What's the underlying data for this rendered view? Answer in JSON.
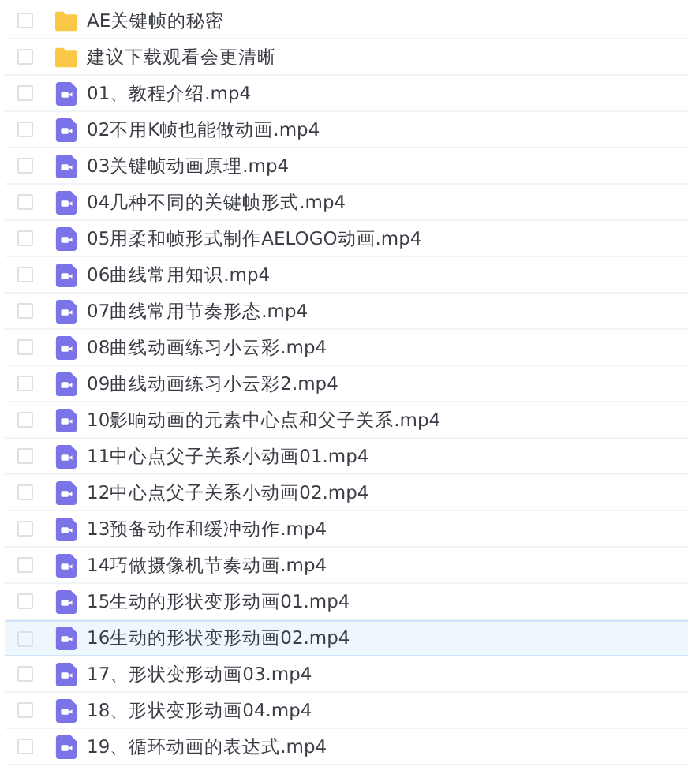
{
  "files": [
    {
      "name": "AE关键帧的秘密",
      "kind": "folder",
      "selected": false
    },
    {
      "name": "建议下载观看会更清晰",
      "kind": "folder",
      "selected": false
    },
    {
      "name": "01、教程介绍.mp4",
      "kind": "video",
      "selected": false
    },
    {
      "name": "02不用K帧也能做动画.mp4",
      "kind": "video",
      "selected": false
    },
    {
      "name": "03关键帧动画原理.mp4",
      "kind": "video",
      "selected": false
    },
    {
      "name": "04几种不同的关键帧形式.mp4",
      "kind": "video",
      "selected": false
    },
    {
      "name": "05用柔和帧形式制作AELOGO动画.mp4",
      "kind": "video",
      "selected": false
    },
    {
      "name": "06曲线常用知识.mp4",
      "kind": "video",
      "selected": false
    },
    {
      "name": "07曲线常用节奏形态.mp4",
      "kind": "video",
      "selected": false
    },
    {
      "name": "08曲线动画练习小云彩.mp4",
      "kind": "video",
      "selected": false
    },
    {
      "name": "09曲线动画练习小云彩2.mp4",
      "kind": "video",
      "selected": false
    },
    {
      "name": "10影响动画的元素中心点和父子关系.mp4",
      "kind": "video",
      "selected": false
    },
    {
      "name": "11中心点父子关系小动画01.mp4",
      "kind": "video",
      "selected": false
    },
    {
      "name": "12中心点父子关系小动画02.mp4",
      "kind": "video",
      "selected": false
    },
    {
      "name": "13预备动作和缓冲动作.mp4",
      "kind": "video",
      "selected": false
    },
    {
      "name": "14巧做摄像机节奏动画.mp4",
      "kind": "video",
      "selected": false
    },
    {
      "name": "15生动的形状变形动画01.mp4",
      "kind": "video",
      "selected": false
    },
    {
      "name": "16生动的形状变形动画02.mp4",
      "kind": "video",
      "selected": true
    },
    {
      "name": "17、形状变形动画03.mp4",
      "kind": "video",
      "selected": false
    },
    {
      "name": "18、形状变形动画04.mp4",
      "kind": "video",
      "selected": false
    },
    {
      "name": "19、循环动画的表达式.mp4",
      "kind": "video",
      "selected": false
    }
  ]
}
